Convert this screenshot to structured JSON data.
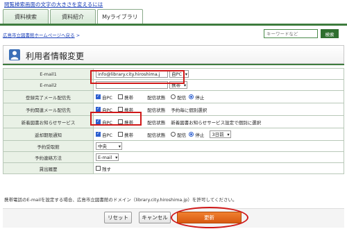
{
  "header": {
    "font_size_link": "閲覧検索画面の文字の大きさを変えるには",
    "tabs": [
      {
        "label": "資料検索"
      },
      {
        "label": "資料紹介"
      },
      {
        "label": "Myライブラリ"
      }
    ],
    "breadcrumb_link": "広島市立図書館ホームページへ戻る",
    "breadcrumb_arrow": ">",
    "search_placeholder": "キーワードなど",
    "search_button": "検索"
  },
  "page_title": "利用者情報変更",
  "form": {
    "email1": {
      "label": "E-mail1",
      "value": "info@library.city.hiroshima.j",
      "type": "自PC"
    },
    "email2": {
      "label": "E-mail2",
      "value": "",
      "type": "携帯"
    },
    "reg_mail": {
      "label": "登録完了メール配信先",
      "self_pc": "自PC",
      "mobile": "携帯",
      "status_label": "配信状態",
      "on": "配信",
      "off": "停止"
    },
    "reserve_mail": {
      "label": "予約関連メール配信先",
      "self_pc": "自PC",
      "mobile": "携帯",
      "status_label": "配信状態",
      "note": "予約毎に個別選択"
    },
    "new_books": {
      "label": "新着図書お知らせサービス",
      "self_pc": "自PC",
      "mobile": "携帯",
      "status_label": "配信状態",
      "note": "新着図書お知らせサービス設定で個別に選択"
    },
    "due_notice": {
      "label": "返却期限通知",
      "self_pc": "自PC",
      "mobile": "携帯",
      "status_label": "配信状態",
      "on": "配信",
      "off": "停止",
      "days": "3日前"
    },
    "pickup_library": {
      "label": "予約受取館",
      "value": "中央"
    },
    "contact_method": {
      "label": "予約連絡方法",
      "value": "E-mail"
    },
    "loan_history": {
      "label": "貸出履歴",
      "option": "残す"
    }
  },
  "note": "携帯電話のE-mailを設定する場合、広島市立図書館のドメイン（library.city.hiroshima.jp）を許可してください。",
  "buttons": {
    "reset": "リセット",
    "cancel": "キャンセル",
    "update": "更新"
  },
  "colors": {
    "accent_green": "#3e7c3e",
    "label_bg": "#e9f1e6",
    "highlight_red": "#d01818",
    "update_orange": "#e06a1a"
  },
  "icons": {
    "page_title": "person-icon"
  }
}
